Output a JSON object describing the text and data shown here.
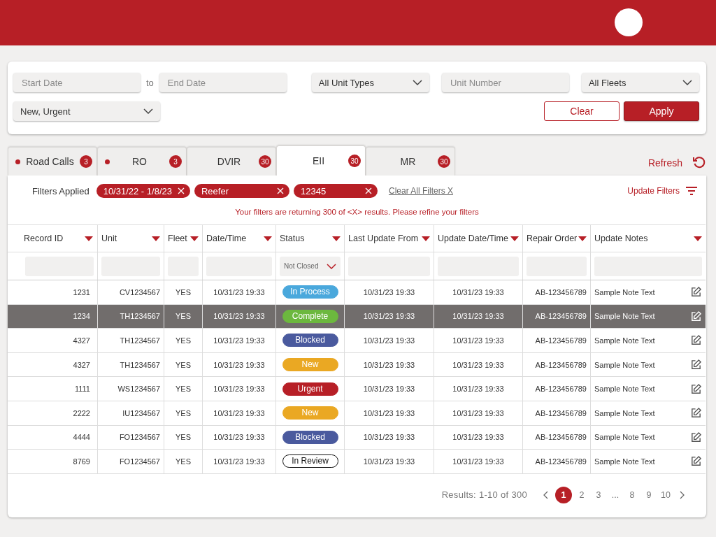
{
  "filters": {
    "start_date": {
      "placeholder": "Start Date"
    },
    "separator": "to",
    "end_date": {
      "placeholder": "End Date"
    },
    "unit_types": {
      "value": "All Unit Types"
    },
    "unit_number": {
      "placeholder": "Unit Number"
    },
    "fleets": {
      "value": "All Fleets"
    },
    "statuses": {
      "value": "New, Urgent"
    },
    "clear_button": "Clear",
    "apply_button": "Apply"
  },
  "tabs": [
    {
      "label": "Road Calls",
      "count": "3",
      "dot": true,
      "selected": false
    },
    {
      "label": "RO",
      "count": "3",
      "dot": true,
      "selected": false
    },
    {
      "label": "DVIR",
      "count": "30",
      "dot": false,
      "selected": false
    },
    {
      "label": "EII",
      "count": "30",
      "dot": false,
      "selected": true
    },
    {
      "label": "MR",
      "count": "30",
      "dot": false,
      "selected": false
    }
  ],
  "refresh": "Refresh",
  "applied": {
    "label": "Filters Applied",
    "chips": [
      "10/31/22 - 1/8/23",
      "Reefer",
      "12345"
    ],
    "clear_all": "Clear All Filters X",
    "update_filters": "Update Filters",
    "warning": "Your filters are returning 300 of  <X> results. Please refine your filters"
  },
  "table": {
    "columns": [
      {
        "label": "Record ID"
      },
      {
        "label": "Unit"
      },
      {
        "label": "Fleet"
      },
      {
        "label": "Date/Time"
      },
      {
        "label": "Status",
        "filter_value": "Not Closed"
      },
      {
        "label": "Last Update From"
      },
      {
        "label": "Update Date/Time"
      },
      {
        "label": "Repair Order"
      },
      {
        "label": "Update Notes"
      }
    ],
    "rows": [
      {
        "selected": false,
        "record_id": "1231",
        "unit": "CV1234567",
        "fleet": "YES",
        "date_time": "10/31/23 19:33",
        "status": {
          "label": "In Process",
          "kind": "filled",
          "color": "#4aa8dc"
        },
        "last_update_from": "10/31/23 19:33",
        "update_date_time": "10/31/23 19:33",
        "repair_order": "AB-123456789",
        "notes": "Sample Note Text"
      },
      {
        "selected": true,
        "record_id": "1234",
        "unit": "TH1234567",
        "fleet": "YES",
        "date_time": "10/31/23 19:33",
        "status": {
          "label": "Complete",
          "kind": "filled",
          "color": "#6cb83e"
        },
        "last_update_from": "10/31/23 19:33",
        "update_date_time": "10/31/23 19:33",
        "repair_order": "AB-123456789",
        "notes": "Sample Note Text"
      },
      {
        "selected": false,
        "record_id": "4327",
        "unit": "TH1234567",
        "fleet": "YES",
        "date_time": "10/31/23 19:33",
        "status": {
          "label": "Blocked",
          "kind": "filled",
          "color": "#4a5a9e"
        },
        "last_update_from": "10/31/23 19:33",
        "update_date_time": "10/31/23 19:33",
        "repair_order": "AB-123456789",
        "notes": "Sample Note Text"
      },
      {
        "selected": false,
        "record_id": "4327",
        "unit": "TH1234567",
        "fleet": "YES",
        "date_time": "10/31/23 19:33",
        "status": {
          "label": "New",
          "kind": "filled",
          "color": "#eaa823"
        },
        "last_update_from": "10/31/23 19:33",
        "update_date_time": "10/31/23 19:33",
        "repair_order": "AB-123456789",
        "notes": "Sample Note Text"
      },
      {
        "selected": false,
        "record_id": "1111",
        "unit": "WS1234567",
        "fleet": "YES",
        "date_time": "10/31/23 19:33",
        "status": {
          "label": "Urgent",
          "kind": "filled",
          "color": "#b71f26"
        },
        "last_update_from": "10/31/23 19:33",
        "update_date_time": "10/31/23 19:33",
        "repair_order": "AB-123456789",
        "notes": "Sample Note Text"
      },
      {
        "selected": false,
        "record_id": "2222",
        "unit": "IU1234567",
        "fleet": "YES",
        "date_time": "10/31/23 19:33",
        "status": {
          "label": "New",
          "kind": "filled",
          "color": "#eaa823"
        },
        "last_update_from": "10/31/23 19:33",
        "update_date_time": "10/31/23 19:33",
        "repair_order": "AB-123456789",
        "notes": "Sample Note Text"
      },
      {
        "selected": false,
        "record_id": "4444",
        "unit": "FO1234567",
        "fleet": "YES",
        "date_time": "10/31/23 19:33",
        "status": {
          "label": "Blocked",
          "kind": "filled",
          "color": "#4a5a9e"
        },
        "last_update_from": "10/31/23 19:33",
        "update_date_time": "10/31/23 19:33",
        "repair_order": "AB-123456789",
        "notes": "Sample Note Text"
      },
      {
        "selected": false,
        "record_id": "8769",
        "unit": "FO1234567",
        "fleet": "YES",
        "date_time": "10/31/23 19:33",
        "status": {
          "label": "In Review",
          "kind": "outline",
          "color": "#111111"
        },
        "last_update_from": "10/31/23 19:33",
        "update_date_time": "10/31/23 19:33",
        "repair_order": "AB-123456789",
        "notes": "Sample Note Text"
      }
    ]
  },
  "pagination": {
    "results": "Results: 1-10 of 300",
    "pages": [
      {
        "label": "1",
        "selected": true
      },
      {
        "label": "2",
        "selected": false
      },
      {
        "label": "3",
        "selected": false
      },
      {
        "label": "...",
        "selected": false
      },
      {
        "label": "8",
        "selected": false
      },
      {
        "label": "9",
        "selected": false
      },
      {
        "label": "10",
        "selected": false
      }
    ]
  }
}
